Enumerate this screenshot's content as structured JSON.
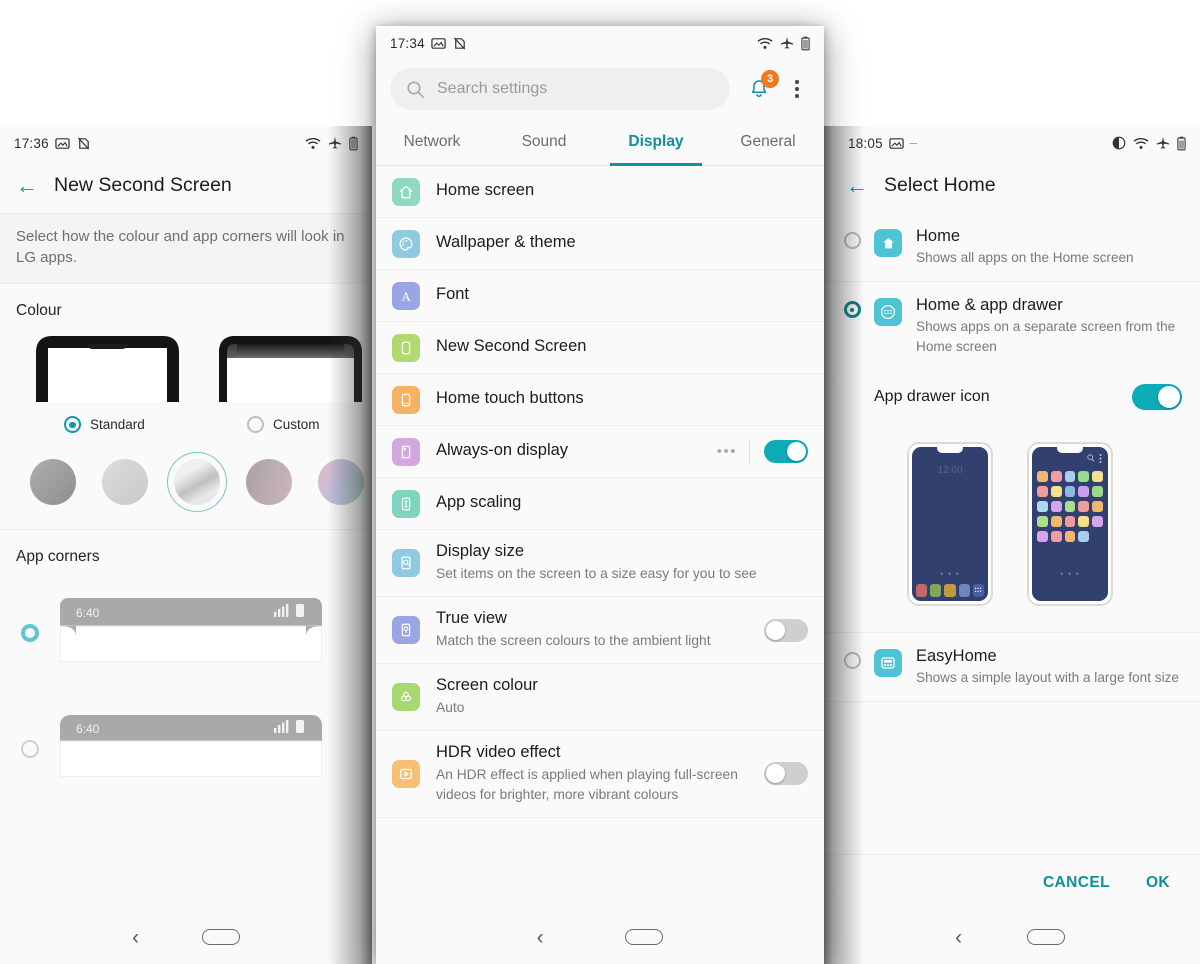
{
  "left_phone": {
    "status_bar": {
      "time": "17:36",
      "icons": [
        "image-icon",
        "no-sim-icon",
        "wifi-icon",
        "airplane-icon",
        "battery-icon"
      ]
    },
    "app_bar": {
      "back": "←",
      "title": "New Second Screen"
    },
    "description": "Select how the colour and app corners will look in LG apps.",
    "colour_section": {
      "label": "Colour",
      "options": [
        {
          "label": "Standard",
          "selected": true
        },
        {
          "label": "Custom",
          "selected": false
        }
      ],
      "swatches": [
        {
          "name": "grey-dark",
          "color": "#9b9b9b",
          "selected": false
        },
        {
          "name": "grey-light",
          "color": "#d2d2d2",
          "selected": false
        },
        {
          "name": "silver-gradient",
          "color": "#d8d8d8",
          "selected": true
        },
        {
          "name": "rose-grey",
          "color": "#b6a2a8",
          "selected": false
        },
        {
          "name": "rainbow",
          "color": "#c6b7d8",
          "selected": false
        }
      ]
    },
    "app_corners_section": {
      "label": "App corners",
      "options": [
        {
          "clock": "6:40",
          "selected": true,
          "style": "rounded"
        },
        {
          "clock": "6:40",
          "selected": false,
          "style": "square"
        }
      ]
    },
    "nav_bar": {
      "back": "back-icon",
      "home": "home-pill-icon"
    }
  },
  "center_phone": {
    "status_bar": {
      "time": "17:34",
      "icons": [
        "image-icon",
        "no-sim-icon",
        "wifi-icon",
        "airplane-icon",
        "battery-icon"
      ]
    },
    "search": {
      "placeholder": "Search settings",
      "icon": "search-icon"
    },
    "notification": {
      "icon": "bell-icon",
      "badge": "3",
      "badge_color": "#f07a1e"
    },
    "overflow": {
      "icon": "kebab-menu-icon"
    },
    "tabs": [
      {
        "label": "Network",
        "active": false
      },
      {
        "label": "Sound",
        "active": false
      },
      {
        "label": "Display",
        "active": true
      },
      {
        "label": "General",
        "active": false
      }
    ],
    "accent_color": "#0e8f9e",
    "items": [
      {
        "title": "Home screen",
        "subtitle": "",
        "icon": "home-icon",
        "icon_bg": "#8fd9c0",
        "control": "none"
      },
      {
        "title": "Wallpaper & theme",
        "subtitle": "",
        "icon": "palette-icon",
        "icon_bg": "#8ecbe0",
        "control": "none"
      },
      {
        "title": "Font",
        "subtitle": "",
        "icon": "font-a-icon",
        "icon_bg": "#9aa6e3",
        "control": "none"
      },
      {
        "title": "New Second Screen",
        "subtitle": "",
        "icon": "phone-notch-icon",
        "icon_bg": "#b0d96f",
        "control": "none"
      },
      {
        "title": "Home touch buttons",
        "subtitle": "",
        "icon": "touch-buttons-icon",
        "icon_bg": "#f5b265",
        "control": "none"
      },
      {
        "title": "Always-on display",
        "subtitle": "",
        "icon": "aod-icon",
        "icon_bg": "#d3a8e0",
        "control": "toggle",
        "toggle_on": true,
        "has_more": true,
        "more_icon": "ellipsis-icon"
      },
      {
        "title": "App scaling",
        "subtitle": "",
        "icon": "app-scaling-icon",
        "icon_bg": "#7fd4bd",
        "control": "none"
      },
      {
        "title": "Display size",
        "subtitle": "Set items on the screen to a size easy for you to see",
        "icon": "display-size-icon",
        "icon_bg": "#8ecbe0",
        "control": "none"
      },
      {
        "title": "True view",
        "subtitle": "Match the screen colours to the ambient light",
        "icon": "true-view-icon",
        "icon_bg": "#9aa6e3",
        "control": "toggle",
        "toggle_on": false
      },
      {
        "title": "Screen colour",
        "subtitle": "Auto",
        "icon": "screen-colour-icon",
        "icon_bg": "#a7d96f",
        "control": "none"
      },
      {
        "title": "HDR video effect",
        "subtitle": "An HDR effect is applied when playing full-screen videos for brighter, more vibrant colours",
        "icon": "hdr-video-icon",
        "icon_bg": "#f5bf74",
        "control": "toggle",
        "toggle_on": false
      }
    ],
    "nav_bar": {
      "back": "back-icon",
      "home": "home-pill-icon"
    }
  },
  "right_phone": {
    "status_bar": {
      "time": "18:05",
      "icons": [
        "image-icon",
        "dash-icon",
        "dnd-icon",
        "wifi-icon",
        "airplane-icon",
        "battery-icon"
      ]
    },
    "app_bar": {
      "back": "←",
      "title": "Select Home"
    },
    "options": [
      {
        "name": "Home",
        "description": "Shows all apps on the Home screen",
        "selected": false,
        "icon": "home-icon",
        "icon_bg": "#4ec3d4"
      },
      {
        "name": "Home & app drawer",
        "description": "Shows apps on a separate screen from the Home screen",
        "selected": true,
        "icon": "app-drawer-icon",
        "icon_bg": "#4ec3d4"
      },
      {
        "name": "EasyHome",
        "description": "Shows a simple layout with a large font size",
        "selected": false,
        "icon": "easyhome-icon",
        "icon_bg": "#4ec3d4"
      }
    ],
    "app_drawer_icon_row": {
      "label": "App drawer icon",
      "toggle_on": true,
      "toggle_color": "#0cabb8"
    },
    "previews": {
      "home_screen": {
        "clock": "12:00"
      },
      "app_drawer": {
        "search_icon": "search-icon",
        "menu_icon": "kebab-menu-icon"
      }
    },
    "footer": {
      "cancel": "CANCEL",
      "ok": "OK"
    },
    "nav_bar": {
      "back": "back-icon",
      "home": "home-pill-icon"
    }
  }
}
